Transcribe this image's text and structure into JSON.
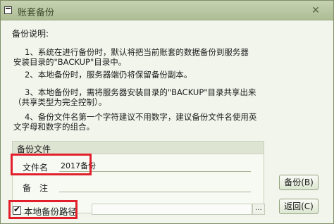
{
  "window": {
    "title": "账套备份",
    "close_glyph": "✕"
  },
  "description": {
    "title": "备份说明:",
    "lines": [
      "1、系统在进行备份时，默认将把当前账套的数据备份到服务器",
      "安装目录的\"BACKUP\"目录中。",
      "2、本地备份时，服务器端仍将保留备份副本。",
      "3、本地备份时，需将服务器安装目录的\"BACKUP\"目录共享出来",
      "（共享类型为完全控制）。",
      "4、备份文件名第一个字符建议不用数字，建议备份文件名使用英",
      "文字母和数字的组合。"
    ]
  },
  "backup_file": {
    "group_title": "备份文件",
    "filename_label": "文件名",
    "filename_value": "2017备份",
    "remark_label": "备　注",
    "remark_value": ""
  },
  "local_path": {
    "checkbox_label": "本地备份路径",
    "checked": true,
    "check_glyph": "✔",
    "path_value": "",
    "browse_label": "..."
  },
  "buttons": {
    "backup_label": "备份(B)",
    "back_label": "返回(C)"
  },
  "colors": {
    "highlight_border": "#e2202c",
    "titlebar": "#b6c49f",
    "window_bg": "#f2f5ec"
  },
  "icons": {
    "title_icon": "window-icon",
    "close_icon": "close-icon",
    "check_icon": "checkmark-icon"
  }
}
